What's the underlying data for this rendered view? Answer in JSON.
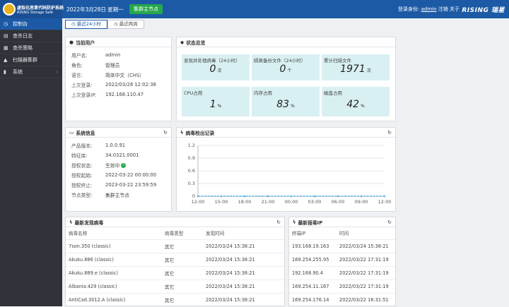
{
  "header": {
    "logo_title": "虚拟化恶意代码防护系统",
    "logo_sub": "RISING Storage Safe",
    "date": "2022年3月28日 星期一",
    "node_button": "集群主节点",
    "login_label": "登录身份:",
    "user": "admin",
    "logout": "注销",
    "about": "关于",
    "brand": "RISING 瑞星"
  },
  "sidebar": {
    "items": [
      {
        "label": "控制台",
        "icon": "dashboard-icon"
      },
      {
        "label": "查杀日志",
        "icon": "list-icon"
      },
      {
        "label": "查杀策略",
        "icon": "policy-icon"
      },
      {
        "label": "扫描器集群",
        "icon": "cluster-icon"
      },
      {
        "label": "系统",
        "icon": "system-icon"
      }
    ]
  },
  "tabs": [
    "最近24小时",
    "最近两周"
  ],
  "current_user": {
    "title": "当前用户",
    "rows": [
      {
        "k": "用户名:",
        "v": "admin"
      },
      {
        "k": "角色:",
        "v": "管理员"
      },
      {
        "k": "语言:",
        "v": "简体中文（CHS）"
      },
      {
        "k": "上次登录:",
        "v": "2022/03/28 12:02:38"
      },
      {
        "k": "上次登录IP:",
        "v": "192.168.110.47"
      }
    ]
  },
  "status": {
    "title": "状态总览",
    "boxes": [
      {
        "label": "发现并处理病毒（24小时）",
        "value": "0",
        "unit": "次"
      },
      {
        "label": "隔离备份文件（24小时）",
        "value": "0",
        "unit": "个"
      },
      {
        "label": "累计扫描文件",
        "value": "1971",
        "unit": "次"
      },
      {
        "label": "CPU占用",
        "value": "1",
        "unit": "%"
      },
      {
        "label": "内存占用",
        "value": "83",
        "unit": "%"
      },
      {
        "label": "磁盘占用",
        "value": "42",
        "unit": "%"
      }
    ]
  },
  "sysinfo": {
    "title": "系统信息",
    "rows": [
      {
        "k": "产品版本:",
        "v": "1.0.0.91"
      },
      {
        "k": "特征库:",
        "v": "34.0321.0001"
      },
      {
        "k": "授权状态:",
        "v": "生效中"
      },
      {
        "k": "授权起始:",
        "v": "2022-03-22 00:00:00"
      },
      {
        "k": "授权终止:",
        "v": "2023-03-22 23:59:59"
      },
      {
        "k": "节点类型:",
        "v": "集群主节点"
      }
    ]
  },
  "chart_data": {
    "type": "line",
    "title": "病毒检出记录",
    "x": [
      "12:00",
      "15:00",
      "18:00",
      "21:00",
      "00:00",
      "03:00",
      "06:00",
      "09:00",
      "12:00"
    ],
    "y_ticks": [
      "0",
      "0.3",
      "0.6",
      "0.9",
      "1.2"
    ],
    "ylim": [
      0,
      1.2
    ],
    "values": [
      0,
      0,
      0,
      0,
      0,
      0,
      0,
      0,
      0
    ],
    "color": "#5ab4e6"
  },
  "virus_table": {
    "title": "最新发现病毒",
    "columns": [
      "病毒名称",
      "病毒类型",
      "发现时间"
    ],
    "rows": [
      [
        "7son.350 (classic)",
        "其它",
        "2022/03/24 15:38:21"
      ],
      [
        "Akuku.886 (classic)",
        "其它",
        "2022/03/24 15:38:21"
      ],
      [
        "Akuku.889.e (classic)",
        "其它",
        "2022/03/24 15:38:21"
      ],
      [
        "Albania.429 (classic)",
        "其它",
        "2022/03/24 15:38:21"
      ],
      [
        "AntiCad.3012.A (classic)",
        "其它",
        "2022/03/24 15:38:21"
      ]
    ]
  },
  "ip_table": {
    "title": "最新报毒IP",
    "columns": [
      "终端IP",
      "时间"
    ],
    "rows": [
      [
        "193.168.19.163",
        "2022/03/24 15:38:21"
      ],
      [
        "169.254.255.95",
        "2022/03/22 17:31:19"
      ],
      [
        "192.168.90.4",
        "2022/03/22 17:31:19"
      ],
      [
        "169.254.11.167",
        "2022/03/22 17:31:19"
      ],
      [
        "169.254.176.14",
        "2022/03/22 16:31:51"
      ]
    ]
  }
}
